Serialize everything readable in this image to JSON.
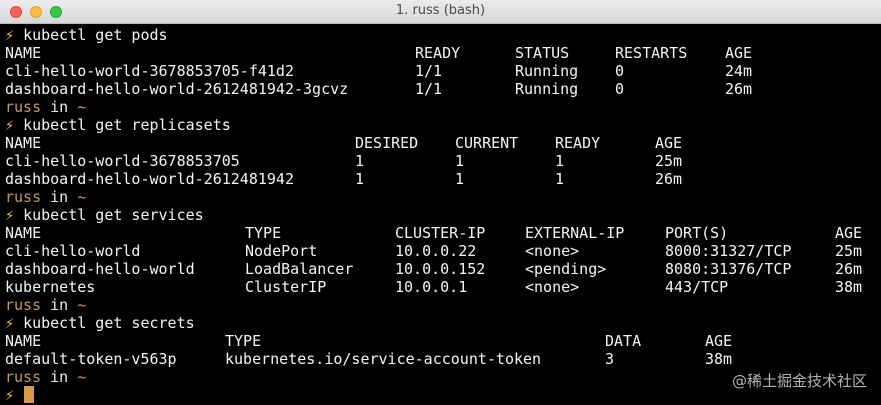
{
  "window": {
    "title": "1. russ (bash)"
  },
  "prompt": {
    "symbol": "⚡",
    "user": "russ",
    "in_word": "in",
    "dir": "~"
  },
  "pods": {
    "command": "kubectl get pods",
    "headers": [
      "NAME",
      "READY",
      "STATUS",
      "RESTARTS",
      "AGE"
    ],
    "rows": [
      [
        "cli-hello-world-3678853705-f41d2",
        "1/1",
        "Running",
        "0",
        "24m"
      ],
      [
        "dashboard-hello-world-2612481942-3gcvz",
        "1/1",
        "Running",
        "0",
        "26m"
      ]
    ]
  },
  "replicasets": {
    "command": "kubectl get replicasets",
    "headers": [
      "NAME",
      "DESIRED",
      "CURRENT",
      "READY",
      "AGE"
    ],
    "rows": [
      [
        "cli-hello-world-3678853705",
        "1",
        "1",
        "1",
        "25m"
      ],
      [
        "dashboard-hello-world-2612481942",
        "1",
        "1",
        "1",
        "26m"
      ]
    ]
  },
  "services": {
    "command": "kubectl get services",
    "headers": [
      "NAME",
      "TYPE",
      "CLUSTER-IP",
      "EXTERNAL-IP",
      "PORT(S)",
      "AGE"
    ],
    "rows": [
      [
        "cli-hello-world",
        "NodePort",
        "10.0.0.22",
        "<none>",
        "8000:31327/TCP",
        "25m"
      ],
      [
        "dashboard-hello-world",
        "LoadBalancer",
        "10.0.0.152",
        "<pending>",
        "8080:31376/TCP",
        "26m"
      ],
      [
        "kubernetes",
        "ClusterIP",
        "10.0.0.1",
        "<none>",
        "443/TCP",
        "38m"
      ]
    ]
  },
  "secrets": {
    "command": "kubectl get secrets",
    "headers": [
      "NAME",
      "TYPE",
      "DATA",
      "AGE"
    ],
    "rows": [
      [
        "default-token-v563p",
        "kubernetes.io/service-account-token",
        "3",
        "38m"
      ]
    ]
  },
  "watermark": "@稀土掘金技术社区"
}
